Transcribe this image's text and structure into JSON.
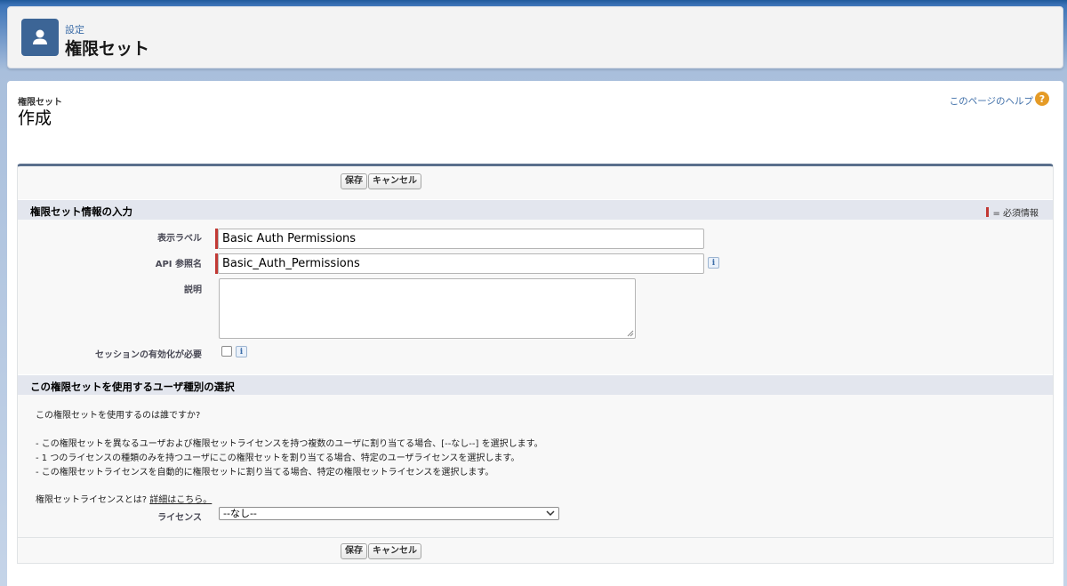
{
  "header": {
    "subtitle": "設定",
    "title": "権限セット",
    "icon": "user-icon"
  },
  "page": {
    "breadcrumb": "権限セット",
    "title": "作成",
    "help_link": "このページのヘルプ",
    "help_icon": "question-icon"
  },
  "buttons": {
    "save": "保存",
    "cancel": "キャンセル"
  },
  "section1": {
    "title": "権限セット情報の入力",
    "required_legend": "= 必須情報",
    "fields": {
      "label_label": "表示ラベル",
      "label_value": "Basic Auth Permissions",
      "api_label": "API 参照名",
      "api_value": "Basic_Auth_Permissions",
      "description_label": "説明",
      "description_value": "",
      "session_label": "セッションの有効化が必要"
    }
  },
  "section2": {
    "title": "この権限セットを使用するユーザ種別の選択",
    "question": "この権限セットを使用するのは誰ですか?",
    "bullets": [
      "- この権限セットを異なるユーザおよび権限セットライセンスを持つ複数のユーザに割り当てる場合、[--なし--] を選択します。",
      "- 1 つのライセンスの種類のみを持つユーザにこの権限セットを割り当てる場合、特定のユーザライセンスを選択します。",
      "- この権限セットライセンスを自動的に権限セットに割り当てる場合、特定の権限セットライセンスを選択します。"
    ],
    "license_question": "権限セットライセンスとは?",
    "license_link": "詳細はこちら。",
    "license_label": "ライセンス",
    "license_value": "--なし--"
  },
  "colors": {
    "required": "#c23934",
    "link": "#3e6ea8",
    "header_icon_bg": "#3c6596",
    "help_icon_bg": "#e59b26"
  }
}
